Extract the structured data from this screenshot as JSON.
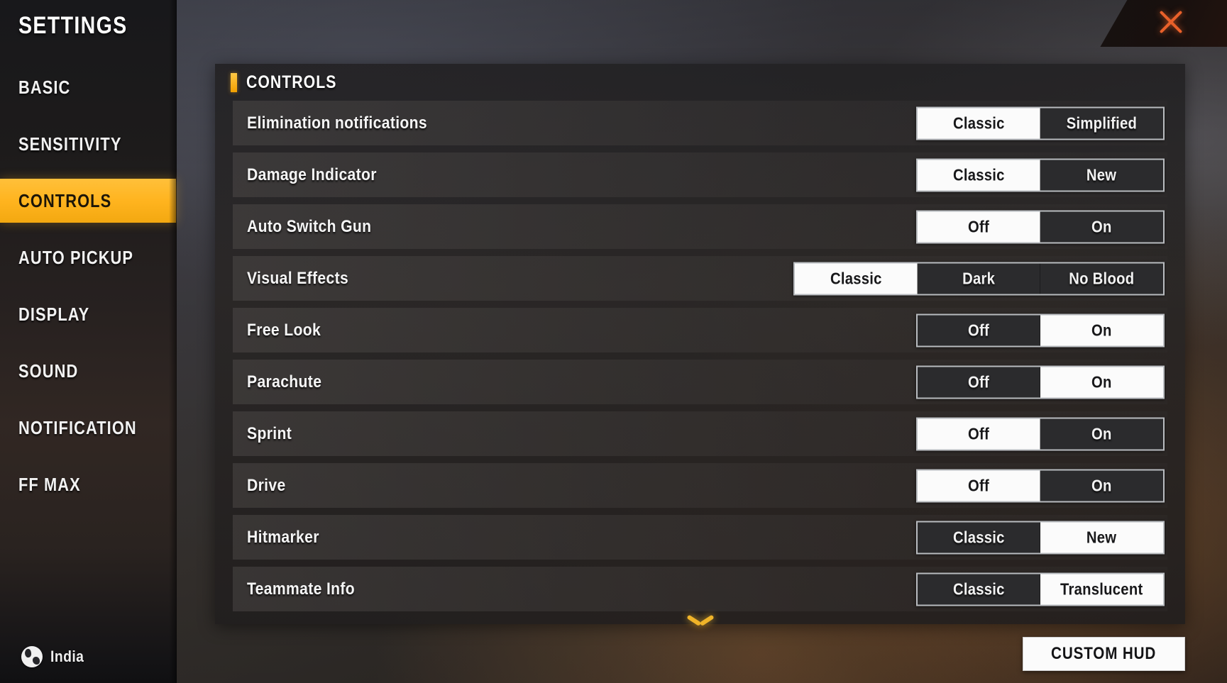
{
  "app": {
    "title": "SETTINGS"
  },
  "sidebar": {
    "title": "SETTINGS",
    "items": [
      {
        "label": "BASIC",
        "active": false
      },
      {
        "label": "SENSITIVITY",
        "active": false
      },
      {
        "label": "CONTROLS",
        "active": true
      },
      {
        "label": "AUTO PICKUP",
        "active": false
      },
      {
        "label": "DISPLAY",
        "active": false
      },
      {
        "label": "SOUND",
        "active": false
      },
      {
        "label": "NOTIFICATION",
        "active": false
      },
      {
        "label": "FF MAX",
        "active": false
      }
    ],
    "country": {
      "label": "India",
      "icon": "globe-icon"
    }
  },
  "titlebar": {
    "close_icon": "close-icon"
  },
  "panel": {
    "title": "CONTROLS",
    "scroll_indicator_icon": "chevron-down-icon",
    "settings": [
      {
        "label": "Elimination notifications",
        "options": [
          "Classic",
          "Simplified"
        ],
        "selected": "Classic"
      },
      {
        "label": "Damage Indicator",
        "options": [
          "Classic",
          "New"
        ],
        "selected": "Classic"
      },
      {
        "label": "Auto Switch Gun",
        "options": [
          "Off",
          "On"
        ],
        "selected": "Off"
      },
      {
        "label": "Visual Effects",
        "options": [
          "Classic",
          "Dark",
          "No Blood"
        ],
        "selected": "Classic"
      },
      {
        "label": "Free Look",
        "options": [
          "Off",
          "On"
        ],
        "selected": "On"
      },
      {
        "label": "Parachute",
        "options": [
          "Off",
          "On"
        ],
        "selected": "On"
      },
      {
        "label": "Sprint",
        "options": [
          "Off",
          "On"
        ],
        "selected": "Off"
      },
      {
        "label": "Drive",
        "options": [
          "Off",
          "On"
        ],
        "selected": "Off"
      },
      {
        "label": "Hitmarker",
        "options": [
          "Classic",
          "New"
        ],
        "selected": "New"
      },
      {
        "label": "Teammate Info",
        "options": [
          "Classic",
          "Translucent"
        ],
        "selected": "Translucent"
      }
    ]
  },
  "footer": {
    "custom_hud_label": "CUSTOM HUD"
  },
  "colors": {
    "accent": "#ffb41f",
    "close": "#e8602a",
    "selected_segment_bg": "#fbfbfb",
    "selected_segment_text": "#18181a"
  }
}
